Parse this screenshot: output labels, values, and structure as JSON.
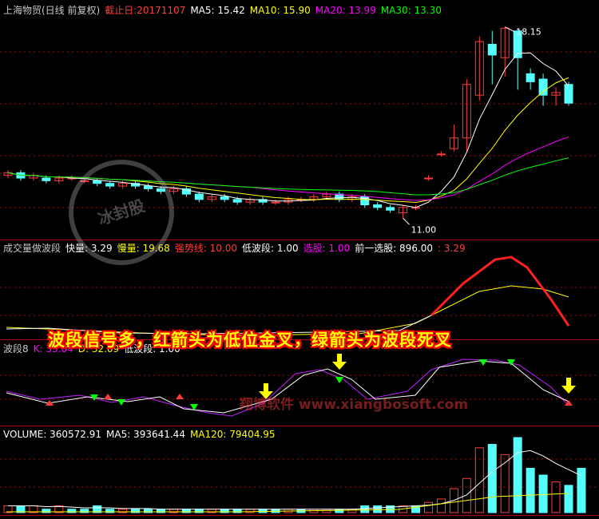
{
  "panels": {
    "price": {
      "title": "上海物贸(日线 前复权)",
      "cutoff_label": "截止日:20171107",
      "ma5": "MA5: 15.42",
      "ma10": "MA10: 15.90",
      "ma20": "MA20: 13.99",
      "ma30": "MA30: 13.30",
      "high_label": "18.15",
      "low_label": "11.00"
    },
    "indicator1": {
      "name": "成交量做波段",
      "fast": "快量: 3.29",
      "slow": "慢量: 19.68",
      "strong": "强势线: 10.00",
      "low_band": "低波段: 1.00",
      "pick": "选股: 1.00",
      "prev_pick": "前一选股: 896.00",
      "extra": ": 3.29"
    },
    "indicator2": {
      "name": "波段8",
      "k": "K: 33.04",
      "d": "D: 32.09",
      "low_band": "低波段: 1.00"
    },
    "volume": {
      "volume": "VOLUME: 360572.91",
      "ma5": "MA5: 393641.44",
      "ma120": "MA120: 79404.95"
    }
  },
  "overlay": {
    "banner": "波段信号多，红箭头为低位金叉，绿箭头为波段死叉",
    "watermark": "翔博软件 www.xiangbosoft.com",
    "stamp": "冰封股"
  },
  "colors": {
    "up": "#ff3c3c",
    "down": "#54ffff",
    "ma5": "#ffffff",
    "ma10": "#ffff00",
    "ma20": "#ff00ff",
    "ma30": "#00ff00",
    "kline": "#ffffff",
    "dline": "#c020ff",
    "axis": "#b00000"
  },
  "chart_data": {
    "type": "candlestick",
    "title": "上海物贸(日线 前复权)",
    "price_range": [
      10.5,
      18.5
    ],
    "annotated_high": 18.15,
    "annotated_low": 11.0,
    "ma_values": {
      "MA5": 15.42,
      "MA10": 15.9,
      "MA20": 13.99,
      "MA30": 13.3
    },
    "candles": [
      {
        "o": 12.6,
        "c": 12.7,
        "h": 12.8,
        "l": 12.5
      },
      {
        "o": 12.7,
        "c": 12.5,
        "h": 12.8,
        "l": 12.4
      },
      {
        "o": 12.5,
        "c": 12.6,
        "h": 12.7,
        "l": 12.4
      },
      {
        "o": 12.5,
        "c": 12.4,
        "h": 12.6,
        "l": 12.3
      },
      {
        "o": 12.4,
        "c": 12.5,
        "h": 12.6,
        "l": 12.3
      },
      {
        "o": 12.5,
        "c": 12.5,
        "h": 12.6,
        "l": 12.4
      },
      {
        "o": 12.4,
        "c": 12.4,
        "h": 12.5,
        "l": 12.3
      },
      {
        "o": 12.4,
        "c": 12.3,
        "h": 12.5,
        "l": 12.2
      },
      {
        "o": 12.3,
        "c": 12.2,
        "h": 12.4,
        "l": 12.1
      },
      {
        "o": 12.2,
        "c": 12.3,
        "h": 12.4,
        "l": 12.1
      },
      {
        "o": 12.3,
        "c": 12.2,
        "h": 12.4,
        "l": 12.1
      },
      {
        "o": 12.2,
        "c": 12.1,
        "h": 12.3,
        "l": 12.0
      },
      {
        "o": 12.1,
        "c": 12.0,
        "h": 12.2,
        "l": 11.9
      },
      {
        "o": 12.0,
        "c": 12.1,
        "h": 12.2,
        "l": 11.9
      },
      {
        "o": 12.1,
        "c": 11.9,
        "h": 12.2,
        "l": 11.8
      },
      {
        "o": 11.9,
        "c": 11.7,
        "h": 12.0,
        "l": 11.6
      },
      {
        "o": 11.7,
        "c": 11.8,
        "h": 11.9,
        "l": 11.6
      },
      {
        "o": 11.8,
        "c": 11.7,
        "h": 11.9,
        "l": 11.6
      },
      {
        "o": 11.7,
        "c": 11.6,
        "h": 11.8,
        "l": 11.5
      },
      {
        "o": 11.6,
        "c": 11.7,
        "h": 11.8,
        "l": 11.5
      },
      {
        "o": 11.7,
        "c": 11.6,
        "h": 11.8,
        "l": 11.5
      },
      {
        "o": 11.6,
        "c": 11.6,
        "h": 11.7,
        "l": 11.5
      },
      {
        "o": 11.6,
        "c": 11.7,
        "h": 11.8,
        "l": 11.5
      },
      {
        "o": 11.7,
        "c": 11.7,
        "h": 11.8,
        "l": 11.6
      },
      {
        "o": 11.7,
        "c": 11.8,
        "h": 11.9,
        "l": 11.6
      },
      {
        "o": 11.8,
        "c": 11.9,
        "h": 12.0,
        "l": 11.7
      },
      {
        "o": 11.9,
        "c": 11.7,
        "h": 12.0,
        "l": 11.6
      },
      {
        "o": 11.7,
        "c": 11.8,
        "h": 11.9,
        "l": 11.6
      },
      {
        "o": 11.8,
        "c": 11.5,
        "h": 11.9,
        "l": 11.4
      },
      {
        "o": 11.5,
        "c": 11.4,
        "h": 11.6,
        "l": 11.3
      },
      {
        "o": 11.4,
        "c": 11.3,
        "h": 11.5,
        "l": 11.2
      },
      {
        "o": 11.2,
        "c": 11.4,
        "h": 11.5,
        "l": 11.0
      },
      {
        "o": 11.4,
        "c": 11.4,
        "h": 11.5,
        "l": 11.3
      },
      {
        "o": 12.5,
        "c": 12.5,
        "h": 12.6,
        "l": 12.4
      },
      {
        "o": 13.4,
        "c": 13.4,
        "h": 13.5,
        "l": 13.3
      },
      {
        "o": 13.6,
        "c": 14.0,
        "h": 14.5,
        "l": 13.5
      },
      {
        "o": 14.0,
        "c": 16.0,
        "h": 16.2,
        "l": 13.5
      },
      {
        "o": 15.6,
        "c": 17.6,
        "h": 17.8,
        "l": 15.4
      },
      {
        "o": 17.5,
        "c": 17.1,
        "h": 18.0,
        "l": 16.0
      },
      {
        "o": 17.0,
        "c": 18.1,
        "h": 18.15,
        "l": 16.3
      },
      {
        "o": 18.0,
        "c": 17.0,
        "h": 18.1,
        "l": 15.8
      },
      {
        "o": 16.4,
        "c": 16.1,
        "h": 16.6,
        "l": 15.8
      },
      {
        "o": 16.2,
        "c": 15.6,
        "h": 16.4,
        "l": 15.2
      },
      {
        "o": 15.6,
        "c": 15.7,
        "h": 15.9,
        "l": 15.2
      },
      {
        "o": 16.0,
        "c": 15.3,
        "h": 16.1,
        "l": 15.2
      }
    ],
    "volume_bars": [
      2,
      2,
      2,
      1,
      2,
      1,
      1,
      2,
      1,
      1,
      1,
      1,
      1,
      1,
      1,
      1,
      1,
      1,
      1,
      1,
      1,
      1,
      1,
      1,
      1,
      1,
      1,
      1,
      2,
      2,
      2,
      2,
      2,
      3,
      4,
      7,
      10,
      19,
      20,
      17,
      22,
      13,
      11,
      9,
      8,
      13
    ],
    "volume_up": [
      true,
      false,
      true,
      false,
      true,
      false,
      false,
      false,
      false,
      true,
      false,
      false,
      false,
      true,
      false,
      false,
      true,
      false,
      false,
      true,
      false,
      false,
      true,
      false,
      true,
      true,
      false,
      true,
      false,
      false,
      false,
      true,
      false,
      true,
      true,
      true,
      true,
      true,
      false,
      true,
      false,
      false,
      false,
      true,
      false,
      false
    ]
  }
}
